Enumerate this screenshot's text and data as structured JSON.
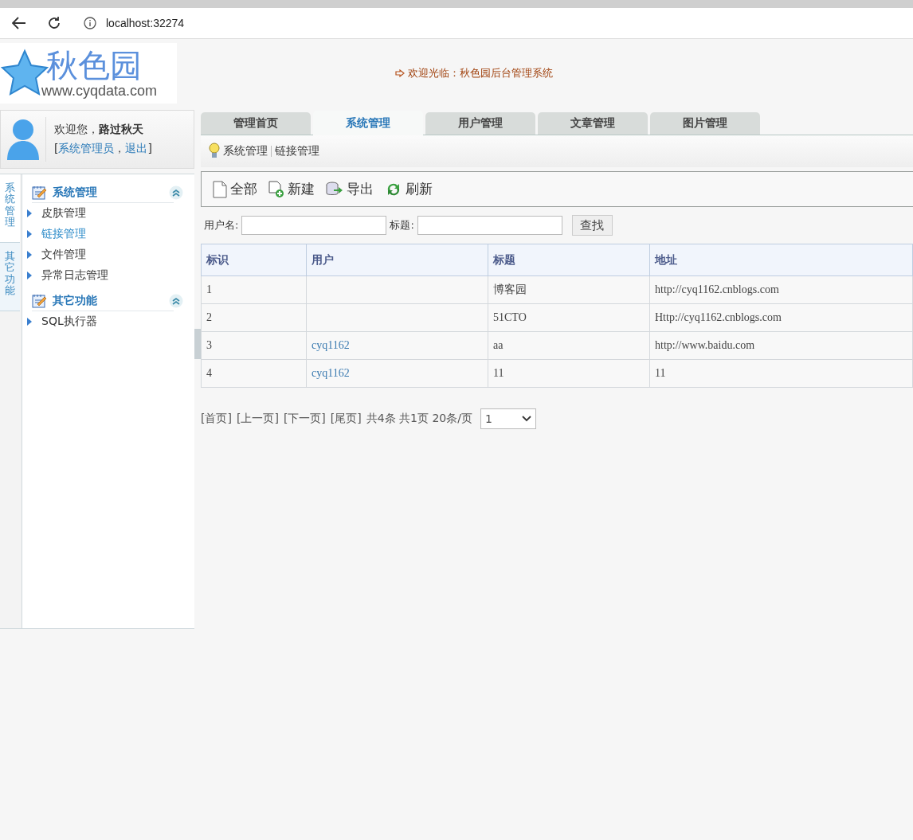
{
  "browser": {
    "address": "localhost:32274"
  },
  "header": {
    "logo_title": "秋色园",
    "logo_url": "www.cyqdata.com",
    "welcome": "欢迎光临：秋色园后台管理系统"
  },
  "user_panel": {
    "greeting": "欢迎您，",
    "name": "路过秋天",
    "bracket_open": "[",
    "role": "系统管理员",
    "separator": "，",
    "logout": "退出",
    "bracket_close": "]"
  },
  "side_tabs": [
    {
      "label": "系统管理",
      "selected": true
    },
    {
      "label": "其它功能",
      "selected": false
    }
  ],
  "menu_groups": [
    {
      "title": "系统管理",
      "items": [
        {
          "label": "皮肤管理",
          "selected": false
        },
        {
          "label": "链接管理",
          "selected": true
        },
        {
          "label": "文件管理",
          "selected": false
        },
        {
          "label": "异常日志管理",
          "selected": false
        }
      ]
    },
    {
      "title": "其它功能",
      "items": [
        {
          "label": "SQL执行器",
          "selected": false
        }
      ]
    }
  ],
  "tabs": [
    {
      "label": "管理首页",
      "selected": false
    },
    {
      "label": "系统管理",
      "selected": true
    },
    {
      "label": "用户管理",
      "selected": false
    },
    {
      "label": "文章管理",
      "selected": false
    },
    {
      "label": "图片管理",
      "selected": false
    }
  ],
  "breadcrumb": [
    "系统管理",
    "链接管理"
  ],
  "toolbar": [
    {
      "label": "全部",
      "kind": "page"
    },
    {
      "label": "新建",
      "kind": "new"
    },
    {
      "label": "导出",
      "kind": "export"
    },
    {
      "label": "刷新",
      "kind": "refresh"
    }
  ],
  "search": {
    "fields": [
      {
        "label": "用户名:"
      },
      {
        "label": "标题:"
      }
    ],
    "button": "查找"
  },
  "table": {
    "columns": [
      "标识",
      "用户",
      "标题",
      "地址"
    ],
    "rows": [
      {
        "id": "1",
        "user": "",
        "title": "博客园",
        "url": "http://cyq1162.cnblogs.com"
      },
      {
        "id": "2",
        "user": "",
        "title": "51CTO",
        "url": "Http://cyq1162.cnblogs.com"
      },
      {
        "id": "3",
        "user": "cyq1162",
        "title": "aa",
        "url": "http://www.baidu.com"
      },
      {
        "id": "4",
        "user": "cyq1162",
        "title": "11",
        "url": "11"
      }
    ]
  },
  "pagination": {
    "links": [
      "[首页]",
      "[上一页]",
      "[下一页]",
      "[尾页]"
    ],
    "summary": "共4条 共1页 20条/页",
    "page": "1"
  }
}
